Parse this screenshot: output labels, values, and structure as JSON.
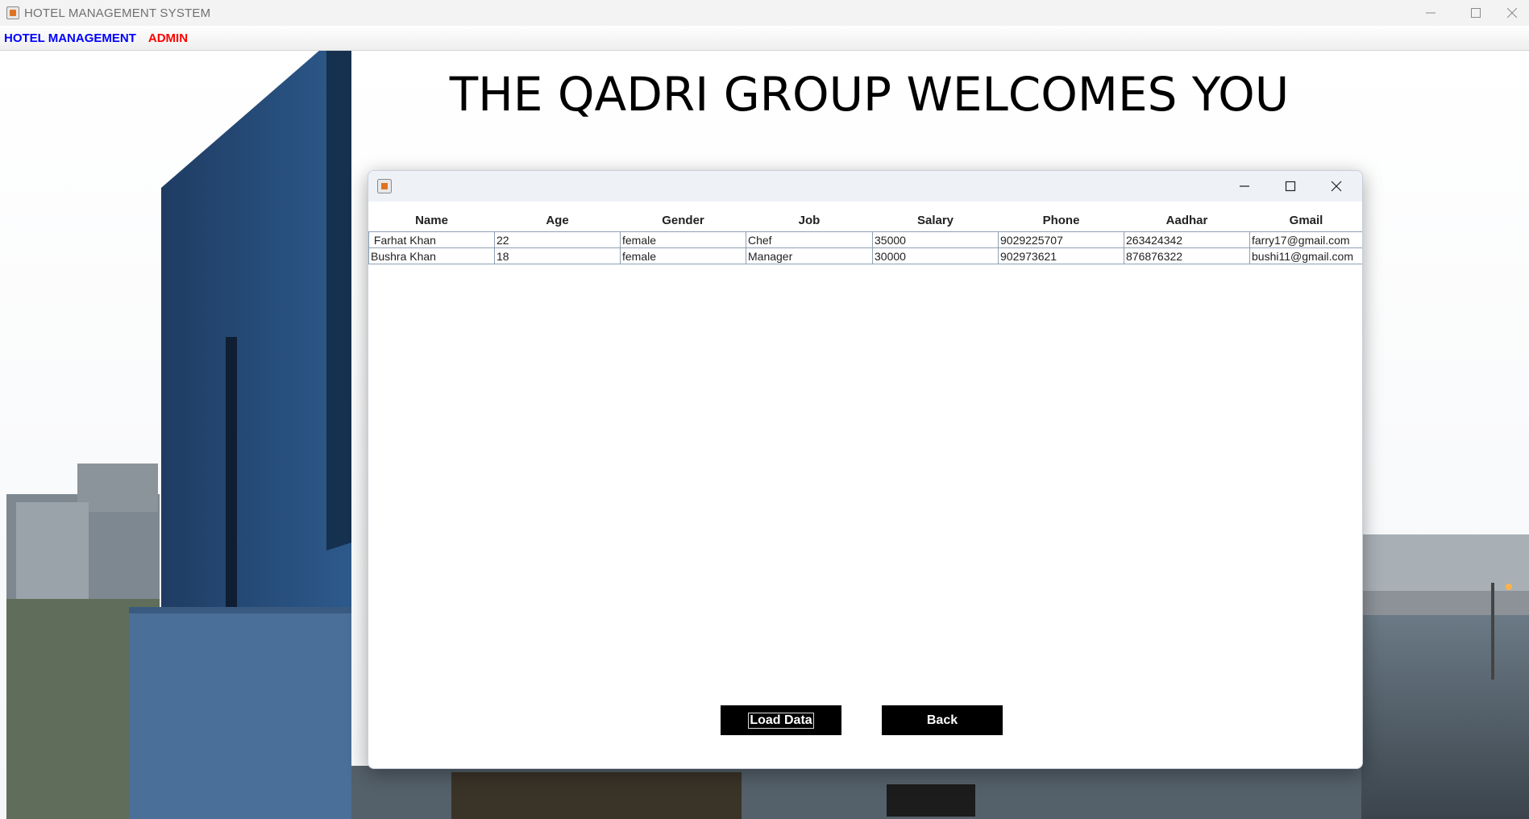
{
  "window": {
    "title": "HOTEL MANAGEMENT SYSTEM",
    "app_icon": "java-cup-icon",
    "controls": [
      "minimize-icon",
      "maximize-icon",
      "close-icon"
    ]
  },
  "menubar": {
    "items": [
      {
        "label": "HOTEL MANAGEMENT",
        "color": "#0000ff"
      },
      {
        "label": "ADMIN",
        "color": "#ff0000"
      }
    ]
  },
  "background": {
    "headline": "THE QADRI GROUP WELCOMES YOU"
  },
  "dialog": {
    "title": "",
    "controls": [
      "minimize-icon",
      "maximize-icon",
      "close-icon"
    ],
    "table": {
      "columns": [
        "Name",
        "Age",
        "Gender",
        "Job",
        "Salary",
        "Phone",
        "Aadhar",
        "Gmail"
      ],
      "rows": [
        [
          " Farhat Khan",
          "22",
          "female",
          "Chef",
          "35000",
          "9029225707",
          "263424342",
          "farry17@gmail.com"
        ],
        [
          "Bushra Khan",
          "18",
          "female",
          "Manager",
          "30000",
          "902973621",
          "876876322",
          "bushi11@gmail.com"
        ]
      ]
    },
    "buttons": {
      "load_label": "Load Data",
      "back_label": "Back"
    }
  }
}
